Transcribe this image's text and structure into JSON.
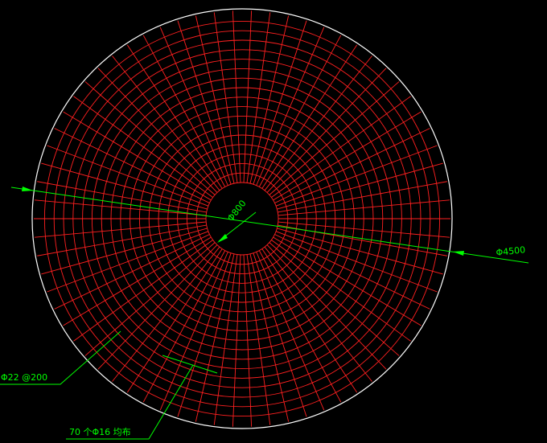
{
  "drawing": {
    "background": "#000000",
    "colors": {
      "outline": "#ffffff",
      "rebar": "#ff2020",
      "dimension": "#00ff00"
    },
    "grid": {
      "radial_bar_count": 70,
      "ring_spacing_label": "@200"
    }
  },
  "labels": {
    "outer_diameter": "Φ4500",
    "inner_diameter": "Φ800",
    "ring_bars": "Φ22 @200",
    "radial_bars": "70 个Φ16 均布"
  }
}
